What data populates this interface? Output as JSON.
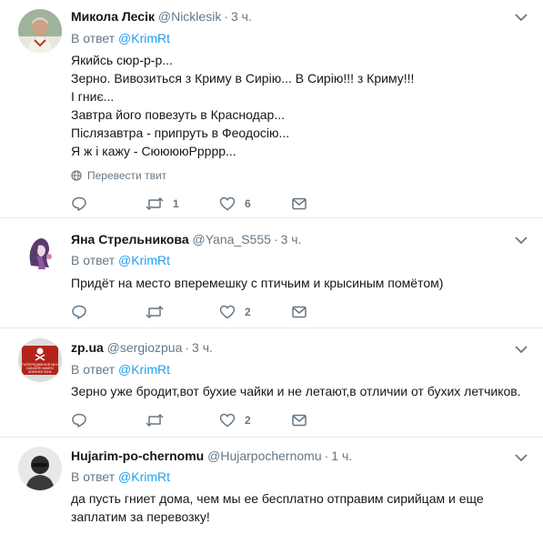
{
  "tweets": [
    {
      "name": "Микола Лесік",
      "handle": "@Nicklesik",
      "dot": "·",
      "time": "3 ч.",
      "reply_prefix": "В ответ",
      "reply_to": "@KrimRt",
      "lines": [
        "Якийсь сюр-р-р...",
        "Зерно. Вивозиться з Криму в Сирію... В Сирію!!! з Криму!!!",
        "І гниє...",
        "Завтра його повезуть в Краснодар...",
        "Післязавтра - припруть в Феодосію...",
        "Я ж і кажу - СююююРрррр..."
      ],
      "translate": "Перевести твит",
      "retweets": "1",
      "likes": "6"
    },
    {
      "name": "Яна Стрельникова",
      "handle": "@Yana_S555",
      "dot": "·",
      "time": "3 ч.",
      "reply_prefix": "В ответ",
      "reply_to": "@KrimRt",
      "lines": [
        "Придёт на место вперемешку с птичьим и крысиным помётом)"
      ],
      "retweets": "",
      "likes": "2"
    },
    {
      "name": "zp.ua",
      "handle": "@sergiozpua",
      "dot": "·",
      "time": "3 ч.",
      "reply_prefix": "В ответ",
      "reply_to": "@KrimRt",
      "lines": [
        "Зерно уже бродит,вот бухие чайки и не летают,в отличии от бухих летчиков."
      ],
      "retweets": "",
      "likes": "2",
      "avatar_text": [
        "ПОПЕРЕДЖЕННЯ МІН!",
        "DANGER! MINES!",
        "ВОЕННАЯ ЗОНА"
      ]
    },
    {
      "name": "Hujarim-po-chernomu",
      "handle": "@Hujarpochernomu",
      "dot": "·",
      "time": "1 ч.",
      "reply_prefix": "В ответ",
      "reply_to": "@KrimRt",
      "lines": [
        "да пусть гниет дома, чем мы ее бесплатно отправим сирийцам и еще заплатим за перевозку!"
      ]
    }
  ],
  "colors": {
    "link": "#1da1f2",
    "secondary": "#657786",
    "divider": "#e6ecf0"
  }
}
